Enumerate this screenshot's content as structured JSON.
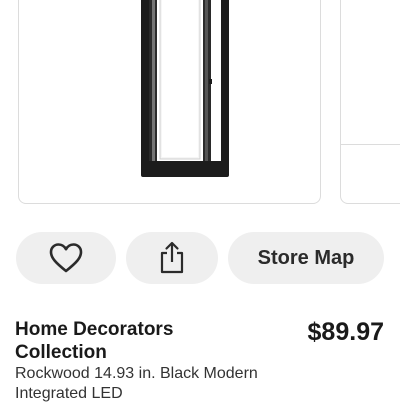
{
  "product": {
    "brand": "Home Decorators Collection",
    "price": "$89.97",
    "name": "Rockwood 14.93 in. Black Modern Integrated LED"
  },
  "actions": {
    "store_map_label": "Store Map",
    "favorite_icon": "heart-icon",
    "share_icon": "share-icon"
  },
  "colors": {
    "button_bg": "#efefef",
    "fixture_black": "#1c1c1c"
  }
}
